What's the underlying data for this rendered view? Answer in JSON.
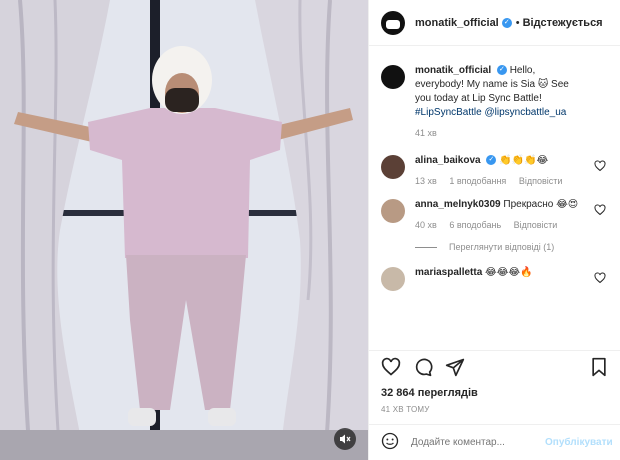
{
  "header": {
    "username": "monatik_official",
    "separator": "•",
    "follow_label": "Відстежується"
  },
  "caption": {
    "username": "monatik_official",
    "text": "Hello, everybody! My name is Sia 🐱 See you today at Lip Sync Battle!",
    "hashtag": "#LipSyncBattle",
    "mention": "@lipsyncbattle_ua",
    "time": "41 хв"
  },
  "comments": [
    {
      "username": "alina_baikova",
      "text": "👏👏👏😂",
      "time": "13 хв",
      "likes": "1 вподобання",
      "reply": "Відповісти"
    },
    {
      "username": "anna_melnyk0309",
      "text": "Прекрасно 😂😍",
      "time": "40 хв",
      "likes": "6 вподобань",
      "reply": "Відповісти"
    },
    {
      "username": "mariaspalletta",
      "text": "😂😂😂🔥"
    }
  ],
  "view_replies": "Переглянути відповіді (1)",
  "stats": {
    "views": "32 864 переглядів",
    "time_ago": "41 ХВ ТОМУ"
  },
  "add_comment": {
    "placeholder": "Додайте коментар...",
    "publish_label": "Опублікувати"
  },
  "colors": {
    "link": "#00376b",
    "verified": "#3897f0",
    "publish": "#b2dffc",
    "muted": "#8e8e8e"
  }
}
